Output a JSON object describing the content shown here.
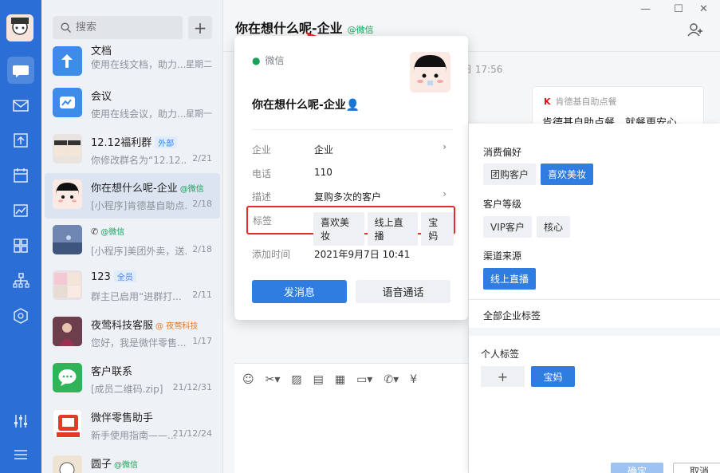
{
  "search": {
    "placeholder": "搜索"
  },
  "conversations": [
    {
      "name": "文档",
      "sub": "使用在线文档，助力...",
      "time": "星期二"
    },
    {
      "name": "会议",
      "sub": "使用在线会议，助力...",
      "time": "星期一"
    },
    {
      "name": "12.12福利群",
      "tag": "外部",
      "sub": "你修改群名为“12.12...",
      "time": "2/21"
    },
    {
      "name": "你在想什么呢-企业",
      "wx": "@微信",
      "sub": "[小程序]肯德基自助点...",
      "time": "2/18"
    },
    {
      "name": "",
      "wx": "@微信",
      "sub": "[小程序]美团外卖，送...",
      "time": "2/18"
    },
    {
      "name": "123",
      "tag": "全员",
      "sub": "群主已启用“进群打...",
      "time": "2/11"
    },
    {
      "name": "夜莺科技客服",
      "org": "@ 夜莺科技",
      "sub": "您好，我是微伴零售...",
      "time": "1/17"
    },
    {
      "name": "客户联系",
      "sub": "[成员二维码.zip]",
      "time": "21/12/31"
    },
    {
      "name": "微伴零售助手",
      "sub": "新手使用指南——...",
      "time": "21/12/24"
    },
    {
      "name": "圆子",
      "wx": "@微信",
      "sub": "",
      "time": ""
    }
  ],
  "header": {
    "title": "你在想什么呢-企业",
    "wx_tag": "@微信"
  },
  "chat": {
    "timestamp": "日 17:56",
    "bubble_source": "肯德基自助点餐",
    "bubble_text": "肯德基自助点餐，就餐更安心。"
  },
  "card": {
    "source": "微信",
    "name": "你在想什么呢-企业",
    "fields": [
      {
        "label": "企业",
        "value": "企业"
      },
      {
        "label": "电话",
        "value": "110"
      },
      {
        "label": "描述",
        "value": "复购多次的客户"
      }
    ],
    "tag_label": "标签",
    "tags": [
      "喜欢美妆",
      "线上直播",
      "宝妈"
    ],
    "add_time_label": "添加时间",
    "add_time": "2021年9月7日 10:41",
    "send_button": "发消息",
    "voice_button": "语音通话"
  },
  "tag_panel": {
    "groups": [
      {
        "title": "消费偏好",
        "tags": [
          {
            "text": "团购客户",
            "selected": false
          },
          {
            "text": "喜欢美妆",
            "selected": true
          }
        ]
      },
      {
        "title": "客户等级",
        "tags": [
          {
            "text": "VIP客户",
            "selected": false
          },
          {
            "text": "核心",
            "selected": false
          }
        ]
      },
      {
        "title": "渠道来源",
        "tags": [
          {
            "text": "线上直播",
            "selected": true
          }
        ]
      }
    ],
    "all_tags_label": "全部企业标签",
    "personal_label": "个人标签",
    "personal_tags": [
      "宝妈"
    ],
    "confirm": "确定",
    "cancel": "取消"
  },
  "colors": {
    "accent": "#2f7de1",
    "rail": "#2b6fd6",
    "wechat_green": "#19a35a",
    "highlight_red": "#e52a2a"
  }
}
